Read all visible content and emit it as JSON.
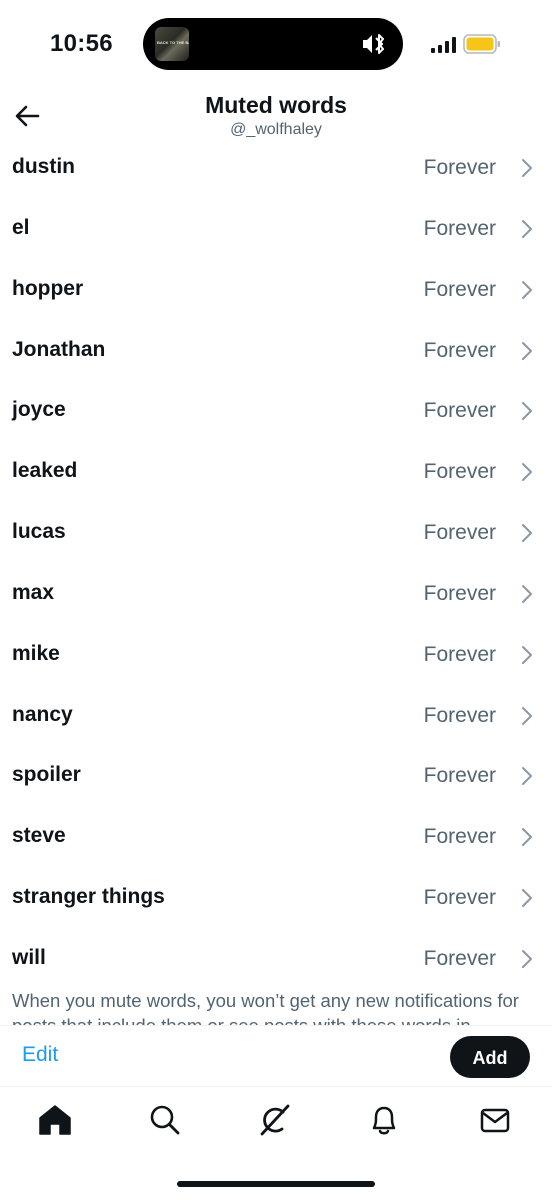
{
  "status_bar": {
    "time": "10:56",
    "island_art_text": "BACK TO THE BASE",
    "icons": [
      "mute-icon",
      "bluetooth-icon",
      "signal-icon",
      "battery-icon"
    ]
  },
  "header": {
    "title": "Muted words",
    "subtitle": "@_wolfhaley",
    "back_icon": "arrow-left-icon"
  },
  "muted_words": [
    {
      "word": "dustin",
      "duration": "Forever"
    },
    {
      "word": "el",
      "duration": "Forever"
    },
    {
      "word": "hopper",
      "duration": "Forever"
    },
    {
      "word": "Jonathan",
      "duration": "Forever"
    },
    {
      "word": "joyce",
      "duration": "Forever"
    },
    {
      "word": "leaked",
      "duration": "Forever"
    },
    {
      "word": "lucas",
      "duration": "Forever"
    },
    {
      "word": "max",
      "duration": "Forever"
    },
    {
      "word": "mike",
      "duration": "Forever"
    },
    {
      "word": "nancy",
      "duration": "Forever"
    },
    {
      "word": "spoiler",
      "duration": "Forever"
    },
    {
      "word": "steve",
      "duration": "Forever"
    },
    {
      "word": "stranger things",
      "duration": "Forever"
    },
    {
      "word": "will",
      "duration": "Forever"
    }
  ],
  "footer_note": "When you mute words, you won’t get any new notifications for posts that include them or see posts with these words in",
  "actions": {
    "edit_label": "Edit",
    "add_label": "Add"
  },
  "bottom_nav": {
    "items": [
      "home-icon",
      "search-icon",
      "grok-icon",
      "notifications-icon",
      "messages-icon"
    ]
  },
  "colors": {
    "text_primary": "#0f1419",
    "text_secondary": "#536471",
    "accent": "#1d9bf0",
    "battery": "#f5c518"
  }
}
